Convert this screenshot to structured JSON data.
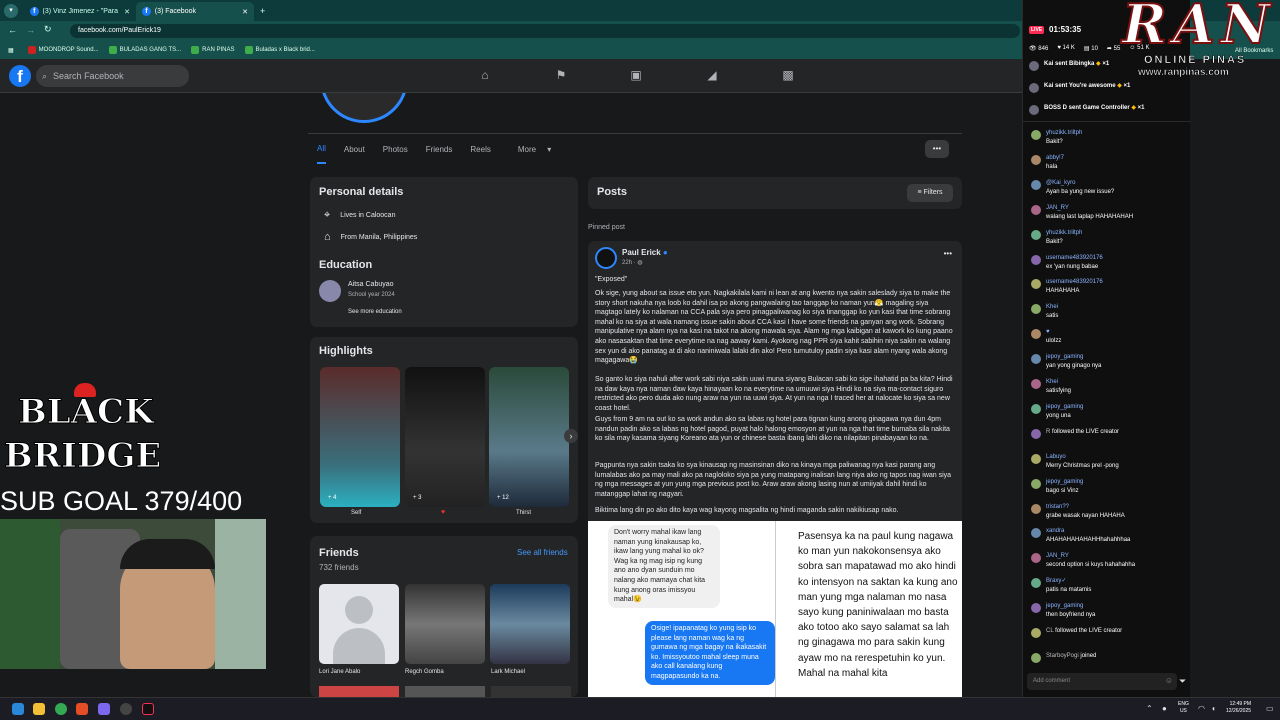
{
  "browser": {
    "tabs": [
      {
        "title": "(3) Vinz Jimenez - \"Para may so"
      },
      {
        "title": "(3) Facebook"
      }
    ],
    "url": "facebook.com/PaulErick19",
    "bookmarks": [
      "MOONDROP Sound...",
      "BULADAS GANG TS...",
      "RAN PINAS",
      "Buladas x Black brid..."
    ],
    "all_bookmarks": "All Bookmarks"
  },
  "facebook": {
    "search_placeholder": "Search Facebook",
    "profile_tabs": [
      "All",
      "About",
      "Photos",
      "Friends",
      "Reels",
      "More"
    ],
    "personal_details": {
      "title": "Personal details",
      "lives_in": "Lives in Caloocan",
      "from": "From Manila, Philippines"
    },
    "education": {
      "title": "Education",
      "school": "Aitsa Cabuyao",
      "year": "School year 2024",
      "see_more": "See more education"
    },
    "highlights": {
      "title": "Highlights",
      "items": [
        {
          "label": "Self",
          "count": "+ 4"
        },
        {
          "label": "",
          "count": "+ 3"
        },
        {
          "label": "Thirst",
          "count": "+ 12"
        }
      ]
    },
    "friends": {
      "title": "Friends",
      "count": "732 friends",
      "see_all": "See all friends",
      "list": [
        "Lori Jane Abalo",
        "Regch Gomba",
        "Lark Michael"
      ]
    },
    "posts": {
      "title": "Posts",
      "filters": "Filters",
      "pinned": "Pinned post",
      "author": "Paul Erick",
      "time": "22h ·",
      "p1": "\"Exposed\"",
      "p2": "Ok sige, yung about sa issue eto yun. Nagkakilala kami ni lean at ang kwento nya sakin saleslady siya to make the story short nakuha nya loob ko dahil isa po akong pangwalaing tao tanggap ko naman yun😤 magaling siya magtago lately ko nalaman na CCA pala siya pero pinagpaliwanag ko siya tinanggap ko yun kasi that time sobrang mahal ko na siya at wala namang issue sakin about CCA kasi I have some friends na ganyan ang work. Sobrang manipulative nya alam nya na kasi na takot na akong mawala siya. Alam ng mga kaibigan at kawork ko kung paano ako nasasaktan that time everytime na nag aaway kami. Ayokong nag PPR siya kahit sabihin niya sakin na walang sex yun di ako panatag at di ako naniniwala lalaki din ako! Pero tumutuloy padin siya kasi alam nyang wala akong magagawa😭",
      "p3": "So ganto ko siya nahuli after work sabi niya sakin uuwi muna siyang Bulacan sabi ko sige ihahatid pa ba kita? Hindi na daw kaya nya naman daw kaya hinayaan ko na everytime na umuuwi siya Hindi ko na siya ma-contact siguro restricted ako pero duda ako nung araw na yun na uuwi siya. At yun na nga I traced her at nalocate ko siya sa new coast hotel.",
      "p4": "Guys from 9 am na out ko sa work andun ako sa labas ng hotel para tignan kung anong ginagawa nya dun 4pm nandun padin ako sa labas ng hotel pagod, puyat halo halong emosyon at yun na nga that time bumaba sila nakita ko sila may kasama siyang Koreano ata yun or chinese basta ibang lahi diko na nilapitan pinabayaan ko na.",
      "p5": "Pagpunta nya sakin tsaka ko sya kinausap ng masinsinan diko na kinaya mga paliwanag nya kasi parang ang lumalabas ako pa may mali ako pa nagloloko siya pa yung matapang inalisan lang niya ako ng tapos nag iwan siya ng mga messages at yun yung mga previous post ko. Araw araw akong lasing nun at umiiyak dahil hindi ko matanggap lahat ng nagyari.",
      "p6": "Biktima lang din po ako dito kaya wag kayong magsalita ng hindi maganda sakin nakikiusap nako.",
      "msg1": "Don't worry mahal ikaw lang naman yung kinakausap ko, ikaw lang yung mahal ko ok? Wag ka ng mag isip ng kung ano ano dyan sunduin mo nalang ako mamaya chat kita kung anong oras imissyou mahal😉",
      "msg2": "Osige! ipapanatag ko yung isip ko please lang naman wag ka ng gumawa ng mga bagay na ikakasakit ko. Imissyoutoo mahal sleep muna ako call kanalang kung magpapasundo ka na.",
      "msg3": "Pasensya ka na paul kung nagawa ko man yun nakokonsensya ako sobra san mapatawad mo ako hindi ko intensyon na saktan ka kung ano man yung mga nalaman mo nasa sayo kung paniniwalaan mo basta ako totoo ako sayo salamat sa lah ng ginagawa mo para sakin kung ayaw mo na rerespetuhin ko yun. Mahal na mahal kita"
    }
  },
  "stream": {
    "live": "LIVE",
    "timer": "01:53:35",
    "stats": [
      "846",
      "14 K",
      "10",
      "55",
      "51 K"
    ],
    "brand": "RAN",
    "brand_sub": "ONLINE PINAS",
    "brand_url": "www.ranpinas.com",
    "overlay_title1": "BLACK",
    "overlay_title2": "BRIDGE",
    "sub_goal": "SUB GOAL 379/400",
    "comment_placeholder": "Add comment",
    "gifts": [
      {
        "text": "Kai sent Bibingka",
        "count": "×1"
      },
      {
        "text": "Kai sent You're awesome",
        "count": "×1"
      },
      {
        "text": "BOSS D sent Game Controller",
        "count": "×1"
      }
    ],
    "comments": [
      {
        "user": "yhuzikk.triltph",
        "text": "Bakit?"
      },
      {
        "user": "abby!7",
        "text": "hala"
      },
      {
        "user": "@Kai_kyro",
        "text": "Ayan ba yung new issue?"
      },
      {
        "user": "JAN_RY",
        "text": "walang last laplap HAHAHAHAH"
      },
      {
        "user": "yhuzikk.triltph",
        "text": "Bakit?"
      },
      {
        "user": "username483920176",
        "text": "ex 'yan nung babae"
      },
      {
        "user": "username483920176",
        "text": "HAHAHAHA"
      },
      {
        "user": "Khei",
        "text": "satis"
      },
      {
        "user": "♥",
        "text": "ulolzz"
      },
      {
        "user": "jepoy_gaming",
        "text": "yan yong ginago nya"
      },
      {
        "user": "Khei",
        "text": "satisfying"
      },
      {
        "user": "jepoy_gaming",
        "text": "yong una"
      },
      {
        "user": "R",
        "text": "followed the LIVE creator"
      },
      {
        "user": "Labuyo",
        "text": "Merry Christmas prel -pong"
      },
      {
        "user": "jepoy_gaming",
        "text": "bago si Vinz"
      },
      {
        "user": "tristan??",
        "text": "grabe wasak nayan HAHAHA"
      },
      {
        "user": "xandra",
        "text": "AHAHAHAHAHAHHhahahhhaa"
      },
      {
        "user": "JAN_RY",
        "text": "second option si kuys hahahahha"
      },
      {
        "user": "Braxy✓",
        "text": "patis na matamis"
      },
      {
        "user": "jepoy_gaming",
        "text": "then boyfriend nya"
      },
      {
        "user": "CL",
        "text": "followed the LIVE creator"
      },
      {
        "user": "StarboyPogi",
        "text": "joined"
      }
    ]
  },
  "taskbar": {
    "lang": "ENG",
    "region": "US",
    "time": "12:49 PM",
    "date": "12/26/2025"
  }
}
